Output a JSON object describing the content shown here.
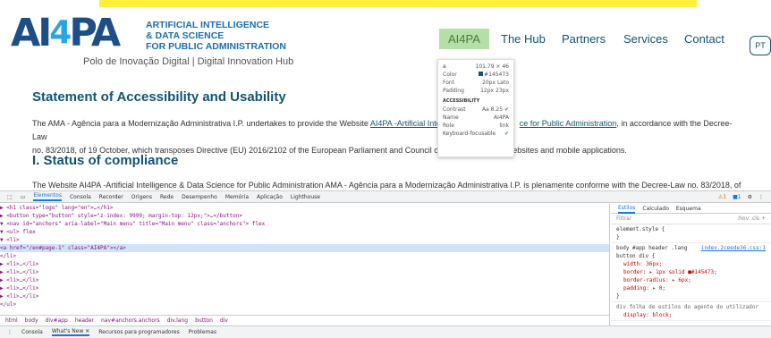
{
  "site": {
    "logo": {
      "ai": "AI",
      "four": "4",
      "pa": "PA",
      "line1": "ARTIFICIAL INTELLIGENCE",
      "line2": "& DATA SCIENCE",
      "line3": "FOR PUBLIC ADMINISTRATION",
      "subtitle": "Polo de Inovação Digital | Digital Innovation Hub"
    },
    "nav": [
      "AI4PA",
      "The Hub",
      "Partners",
      "Services",
      "Contact"
    ],
    "lang": "PT",
    "heading1": "Statement of Accessibility and Usability",
    "para1_a": "The AMA - Agência para a Modernização Administrativa I.P. undertakes to provide the Website ",
    "para1_link1": "AI4PA -Artificial Inte",
    "para1_gap": "",
    "para1_link2": "ce for Public Administration",
    "para1_b": ", in accordance with the Decree-Law",
    "para1_c": "no. 83/2018, of 19 October, which transposes Directive (EU) 2016/2102 of the European Parliament and Council or",
    "para1_d": "ebsites and mobile applications.",
    "heading2": "I. Status of compliance",
    "para2": "The Website AI4PA -Artificial Intelligence & Data Science for Public Administration AMA - Agência para a Modernização Administrativa I.P. is plenamente conforme with the Decree-Law no. 83/2018, of"
  },
  "tooltip": {
    "tag": "a",
    "size": "101.79 × 46",
    "rows": [
      {
        "k": "Color",
        "v": "#145473"
      },
      {
        "k": "Font",
        "v": "20px Lato"
      },
      {
        "k": "Padding",
        "v": "12px 23px"
      }
    ],
    "access_title": "ACCESSIBILITY",
    "contrast_k": "Contrast",
    "contrast_v": "Aa  8.25",
    "name_k": "Name",
    "name_v": "AI4PA",
    "role_k": "Role",
    "role_v": "link",
    "kbd_k": "Keyboard-focusable"
  },
  "devtools": {
    "tabs": [
      "Elementos",
      "Consola",
      "Recorder",
      "Origens",
      "Rede",
      "Desempenho",
      "Memória",
      "Aplicação",
      "Lighthouse"
    ],
    "warn_count": "1",
    "info_count": "1",
    "dom": [
      "▶ <h1 class=\"logo\" lang=\"en\">…</h1>",
      "▶ <button type=\"button\" style=\"z-index: 9999; margin-top: 12px;\">…</button>",
      "▼ <nav id=\"anchors\" aria-label=\"Main menu\" title=\"Main menu\" class=\"anchors\">  flex",
      "   ▼ <ul>  flex",
      "      ▼ <li>",
      "            <a href=\"/en#page-1\" class=\"AI4PA\"></a>",
      "         </li>",
      "      ▶ <li>…</li>",
      "      ▶ <li>…</li>",
      "      ▶ <li>…</li>",
      "      ▶ <li>…</li>",
      "      ▶ <li>…</li>",
      "   </ul>"
    ],
    "crumbs": [
      "html",
      "body",
      "div#app",
      "header",
      "nav#anchors.anchors",
      "div.lang",
      "button",
      "div"
    ],
    "styles_tabs": [
      "Estilos",
      "Calculado",
      "Esquema"
    ],
    "filter_placeholder": "Filtrar",
    "filter_right": ":hov  .cls  +",
    "rule1": "element.style {",
    "rule1_end": "}",
    "rule2_sel": "body #app header .lang button div {",
    "rule2_src": "index.2ceede36.css:1",
    "rule2_props": [
      "width: 36px;",
      "border: ▸ 1px solid ■#145473;",
      "border-radius: ▸ 6px;",
      "padding: ▸ 0;"
    ],
    "rule2_end": "}",
    "rule3": "div   folha de estilos do agente do utilizador",
    "rule3_prop": "display: block;",
    "drawer": [
      "Consola",
      "What's New ✕",
      "Recursos para programadores",
      "Problemas"
    ]
  }
}
